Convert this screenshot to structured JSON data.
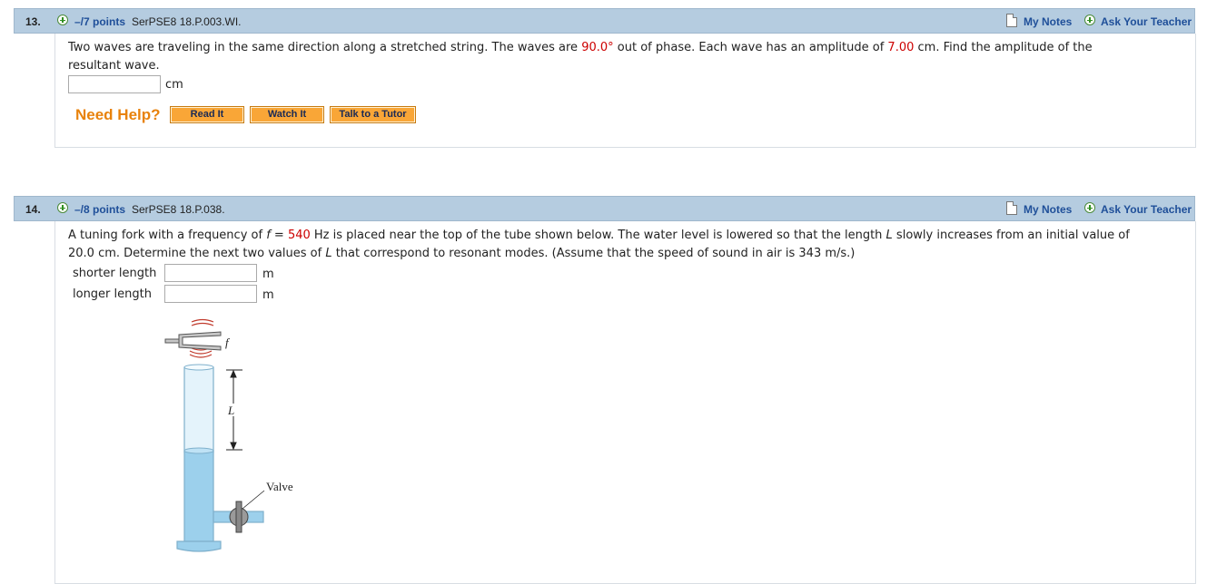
{
  "q13": {
    "number": "13.",
    "points": "–/7 points",
    "code": "SerPSE8 18.P.003.WI.",
    "my_notes": "My Notes",
    "ask_teacher": "Ask Your Teacher",
    "text_1": "Two waves are traveling in the same direction along a stretched string. The waves are ",
    "phase": "90.0°",
    "text_2": " out of phase. Each wave has an amplitude of ",
    "amplitude": "7.00",
    "text_3": " cm. Find the amplitude of the",
    "text_4": "resultant wave.",
    "answer_value": "",
    "unit": "cm",
    "need_help": "Need Help?",
    "buttons": [
      "Read It",
      "Watch It",
      "Talk to a Tutor"
    ]
  },
  "q14": {
    "number": "14.",
    "points": "–/8 points",
    "code": "SerPSE8 18.P.038.",
    "my_notes": "My Notes",
    "ask_teacher": "Ask Your Teacher",
    "text_1": "A tuning fork with a frequency of ",
    "f_var": "f",
    "text_eq": " = ",
    "frequency": "540",
    "text_2": " Hz is placed near the top of the tube shown below. The water level is lowered so that the length ",
    "L_var": "L",
    "text_3": " slowly increases from an initial value of",
    "text_4a": "20.0 cm. Determine the next two values of ",
    "text_4b": " that correspond to resonant modes. (Assume that the speed of sound in air is 343 m/s.)",
    "fields": [
      {
        "label": "shorter length",
        "value": "",
        "unit": "m"
      },
      {
        "label": "longer length",
        "value": "",
        "unit": "m"
      }
    ],
    "figure": {
      "f_label": "f",
      "L_label": "L",
      "valve_label": "Valve"
    }
  },
  "colors": {
    "header_bg": "#b5cce0",
    "link": "#1f4f99",
    "highlight_red": "#cc0000",
    "need_help": "#e8820c",
    "button_bg": "#f9a637"
  }
}
